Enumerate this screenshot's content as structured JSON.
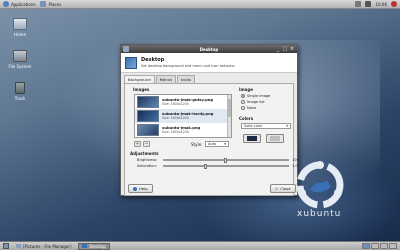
{
  "top_panel": {
    "applications_label": "Applications",
    "places_label": "Places",
    "clock": "10:06"
  },
  "desktop_icons": [
    {
      "label": "Home"
    },
    {
      "label": "File System"
    },
    {
      "label": "Trash"
    }
  ],
  "window": {
    "title": "Desktop",
    "header_title": "Desktop",
    "header_subtitle": "Set desktop background and menu and icon behavior",
    "tabs": [
      {
        "label": "Background",
        "active": true
      },
      {
        "label": "Menus",
        "active": false
      },
      {
        "label": "Icons",
        "active": false
      }
    ],
    "images_section": "Images",
    "images": [
      {
        "name": "xubuntu-jmak-gutsy.png",
        "size": "Size: 1600x1200"
      },
      {
        "name": "xubuntu-jmak-hardy.png",
        "size": "Size: 1600x1200"
      },
      {
        "name": "xubuntu-jmak.png",
        "size": "Size: 1600x1200"
      }
    ],
    "style_label": "Style:",
    "style_value": "Auto",
    "image_section": "Image",
    "image_options": [
      {
        "label": "Single image",
        "selected": true
      },
      {
        "label": "Image list",
        "selected": false
      },
      {
        "label": "None",
        "selected": false
      }
    ],
    "colors_section": "Colors",
    "color_mode": "Solid color",
    "color1": "#1b2a44",
    "color2": "#bdbdbd",
    "adjustments_section": "Adjustments",
    "brightness_label": "Brightness:",
    "brightness_value": "100",
    "saturation_label": "Saturation:",
    "saturation_value": "1.0",
    "help_label": "Help",
    "close_label": "Close"
  },
  "logo_text": "xubuntu",
  "taskbar": {
    "items": [
      {
        "label": "[Pictures - File Manager]",
        "active": false
      },
      {
        "label": "Desktop",
        "active": true
      }
    ]
  },
  "colors": {
    "accent": "#3b6fb4",
    "panel": "#c4c4c4"
  }
}
